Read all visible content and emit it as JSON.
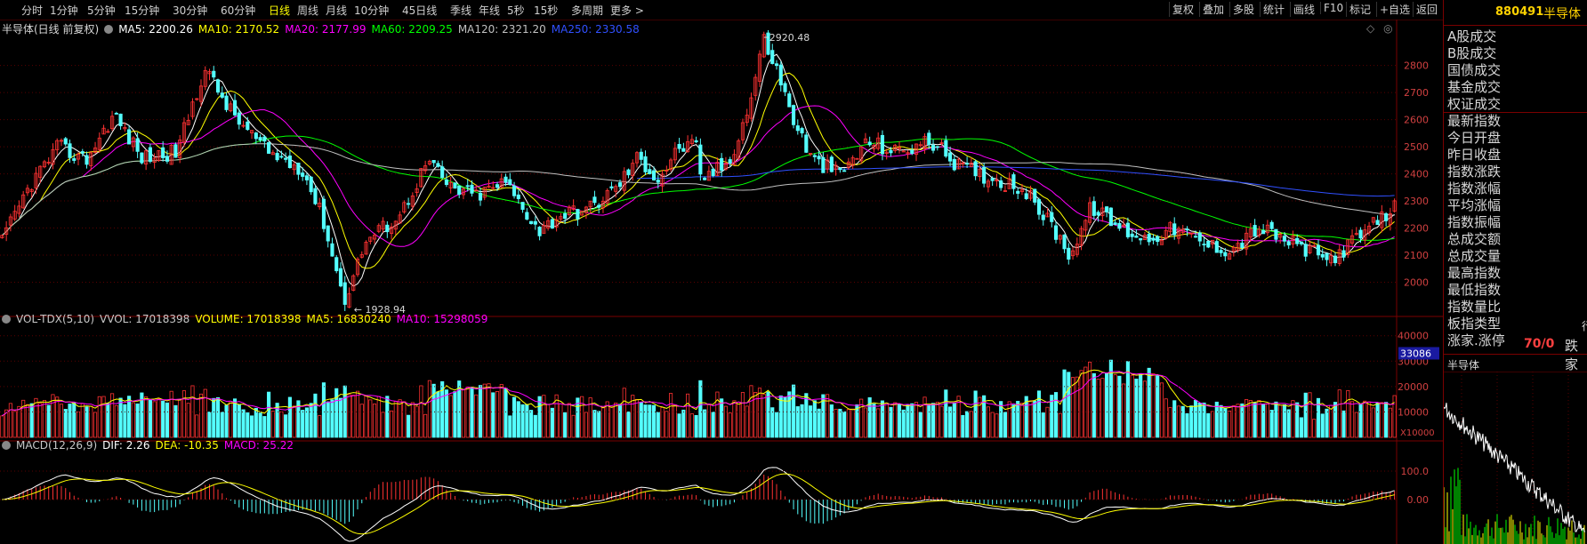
{
  "toolbar": {
    "timeframes": [
      "分时",
      "1分钟",
      "5分钟",
      "15分钟",
      "30分钟",
      "60分钟",
      "日线",
      "周线",
      "月线",
      "10分钟",
      "45日线",
      "季线",
      "年线",
      "5秒",
      "15秒",
      "多周期",
      "更多 >"
    ],
    "active_timeframe": "日线",
    "right_buttons": [
      "复权",
      "叠加",
      "多股",
      "统计",
      "画线",
      "F10",
      "标记",
      "+自选",
      "返回"
    ]
  },
  "main_chart": {
    "title": "半导体(日线 前复权)",
    "ma_labels": [
      {
        "text": "MA5: 2200.26",
        "color": "#ffffff"
      },
      {
        "text": "MA10: 2170.52",
        "color": "#ffff00"
      },
      {
        "text": "MA20: 2177.99",
        "color": "#ff00ff"
      },
      {
        "text": "MA60: 2209.25",
        "color": "#00ff00"
      },
      {
        "text": "MA120: 2321.20",
        "color": "#c0c0c0"
      },
      {
        "text": "MA250: 2330.58",
        "color": "#3050ff"
      }
    ],
    "y_ticks": [
      "2800",
      "2700",
      "2600",
      "2500",
      "2400",
      "2300",
      "2200",
      "2100",
      "2000"
    ],
    "y_range": [
      1900,
      2930
    ],
    "high_label": "2920.48",
    "low_label": "1928.94"
  },
  "volume_chart": {
    "labels": [
      {
        "text": "VOL-TDX(5,10)",
        "color": "#c8c8c8"
      },
      {
        "text": "VVOL: 17018398",
        "color": "#c8c8c8"
      },
      {
        "text": "VOLUME: 17018398",
        "color": "#ffff00"
      },
      {
        "text": "MA5: 16830240",
        "color": "#ffff00"
      },
      {
        "text": "MA10: 15298059",
        "color": "#ff00ff"
      }
    ],
    "y_ticks": [
      "40000",
      "30000",
      "20000",
      "10000"
    ],
    "unit": "X10000",
    "highlight_value": "33086"
  },
  "macd_chart": {
    "labels": [
      {
        "text": "MACD(12,26,9)",
        "color": "#c8c8c8"
      },
      {
        "text": "DIF: 2.26",
        "color": "#ffffff"
      },
      {
        "text": "DEA: -10.35",
        "color": "#ffff00"
      },
      {
        "text": "MACD: 25.22",
        "color": "#ff00ff"
      }
    ],
    "y_ticks": [
      "100.0",
      "0.00"
    ]
  },
  "right_panel": {
    "code": "880491",
    "name": "半导体",
    "items": [
      "A股成交",
      "B股成交",
      "国债成交",
      "基金成交",
      "权证成交",
      "最新指数",
      "今日开盘",
      "昨日收盘",
      "指数涨跌",
      "指数涨幅",
      "平均涨幅",
      "指数振幅",
      "总成交额",
      "总成交量",
      "最高指数",
      "最低指数",
      "指数量比",
      "板指类型",
      "涨家.涨停"
    ],
    "zt_value": "70/0",
    "die_label": "跌家",
    "xing_label": "行",
    "mini_title": "半导体"
  },
  "colors": {
    "up": "#ff3232",
    "down": "#54ffff",
    "grid": "#5a0000",
    "axis_text": "#d04040"
  }
}
